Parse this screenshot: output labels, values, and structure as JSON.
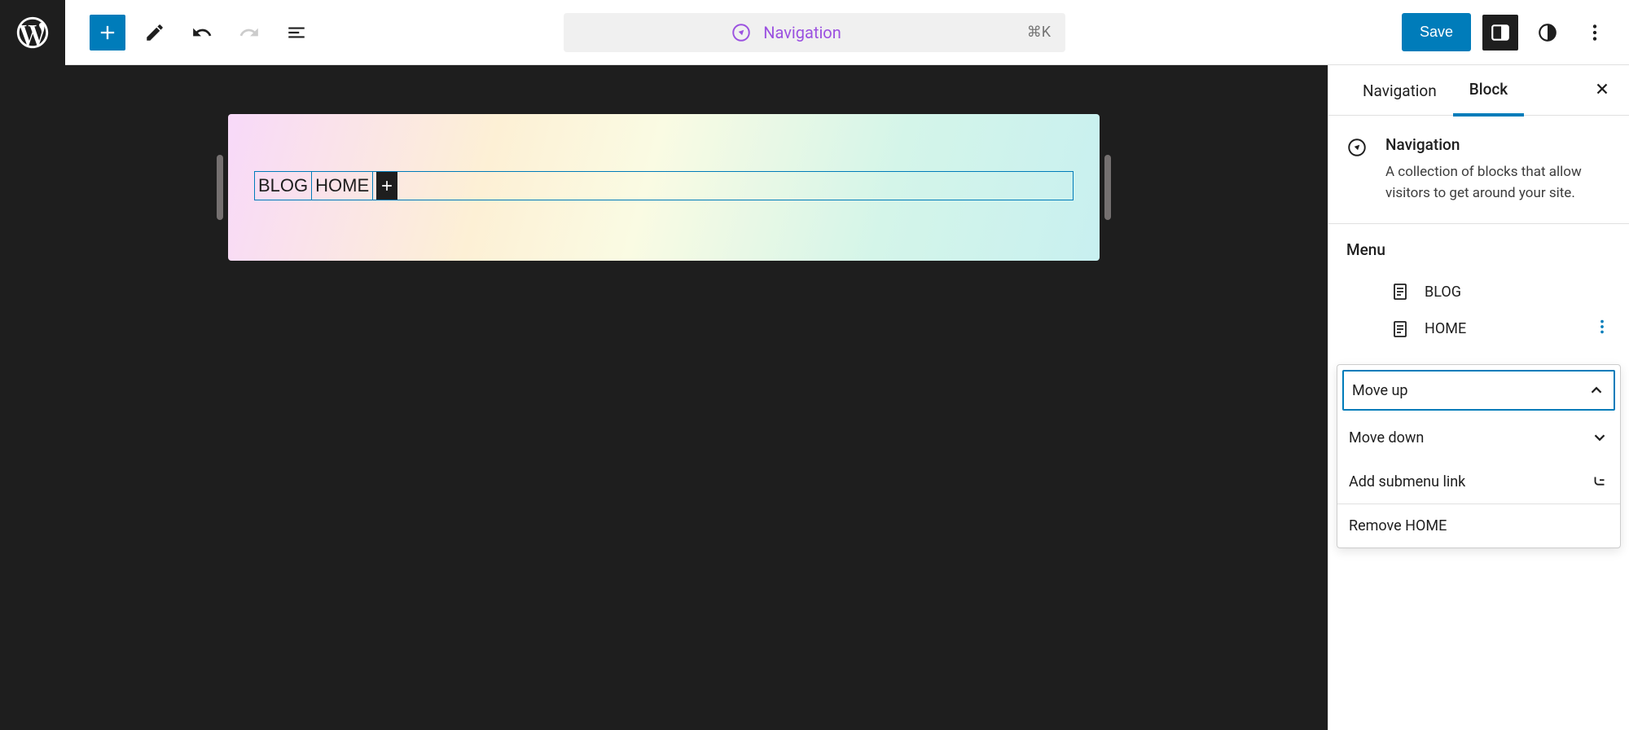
{
  "header": {
    "center_title": "Navigation",
    "shortcut": "⌘K",
    "save_label": "Save"
  },
  "canvas": {
    "nav_items": [
      "BLOG",
      "HOME"
    ]
  },
  "sidebar": {
    "tabs": {
      "nav": "Navigation",
      "block": "Block"
    },
    "block_info": {
      "title": "Navigation",
      "desc": "A collection of blocks that allow visitors to get around your site."
    },
    "menu": {
      "title": "Menu",
      "items": [
        "BLOG",
        "HOME"
      ]
    },
    "popover": {
      "move_up": "Move up",
      "move_down": "Move down",
      "add_submenu": "Add submenu link",
      "remove": "Remove HOME"
    }
  }
}
